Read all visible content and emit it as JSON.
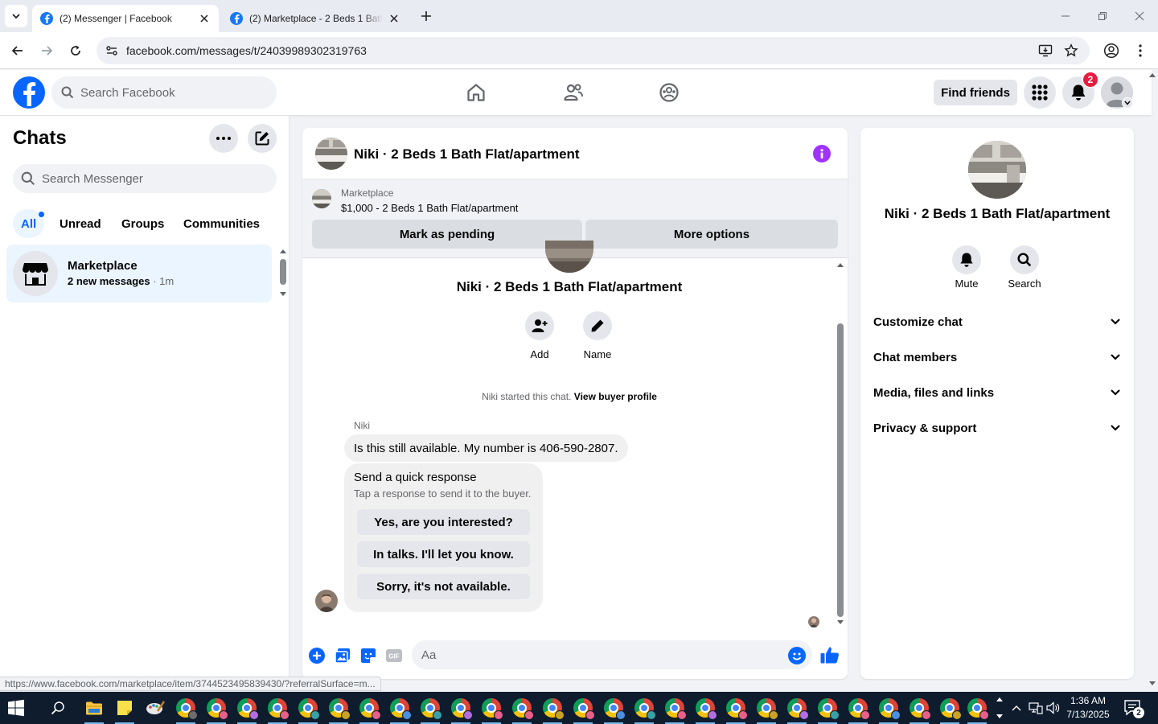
{
  "browser": {
    "tabs": [
      {
        "title": "(2) Messenger | Facebook",
        "active": true
      },
      {
        "title": "(2) Marketplace - 2 Beds 1 Bath",
        "active": false
      }
    ],
    "url": "facebook.com/messages/t/24039989302319763",
    "status_url": "https://www.facebook.com/marketplace/item/3744523495839430/?referralSurface=m..."
  },
  "fb_header": {
    "search_placeholder": "Search Facebook",
    "find_friends_label": "Find friends",
    "notification_count": "2",
    "brand_color": "#0866ff"
  },
  "chat_list": {
    "title": "Chats",
    "search_placeholder": "Search Messenger",
    "filters": [
      "All",
      "Unread",
      "Groups",
      "Communities"
    ],
    "active_filter": "All",
    "conversations": [
      {
        "name": "Marketplace",
        "preview": "2 new messages",
        "time": " · 1m"
      }
    ]
  },
  "conversation": {
    "title": "Niki · 2 Beds 1 Bath Flat/apartment",
    "listing": {
      "source": "Marketplace",
      "summary": "$1,000 - 2 Beds 1 Bath Flat/apartment",
      "buttons": [
        "Mark as pending",
        "More options"
      ]
    },
    "thread_name": "Niki · 2 Beds 1 Bath Flat/apartment",
    "actions": [
      "Add",
      "Name"
    ],
    "system_note": "Niki started this chat. ",
    "system_link": "View buyer profile",
    "sender": "Niki",
    "message": "Is this still available. My number is 406-590-2807.",
    "quick_response": {
      "title": "Send a quick response",
      "subtitle": "Tap a response to send it to the buyer.",
      "options": [
        "Yes, are you interested?",
        "In talks. I'll let you know.",
        "Sorry, it's not available."
      ]
    },
    "composer_placeholder": "Aa",
    "accent_color": "#0866ff",
    "info_color": "#a033ff"
  },
  "details": {
    "name": "Niki · 2 Beds 1 Bath Flat/apartment",
    "actions": [
      "Mute",
      "Search"
    ],
    "sections": [
      "Customize chat",
      "Chat members",
      "Media, files and links",
      "Privacy & support"
    ]
  },
  "taskbar": {
    "time": "1:36 AM",
    "date": "7/13/2025",
    "notification_count": "2"
  }
}
